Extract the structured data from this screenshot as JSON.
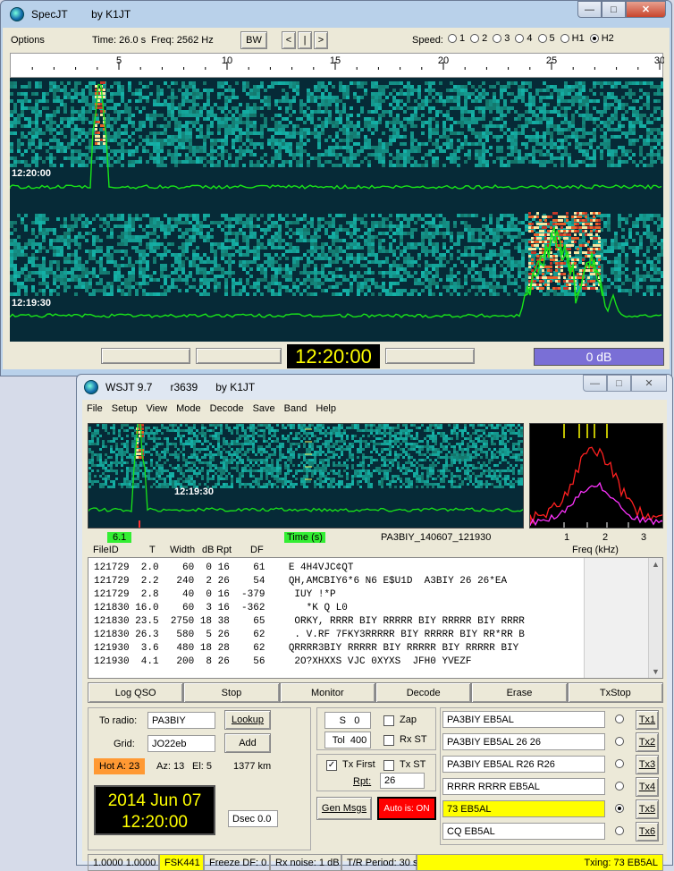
{
  "colors": {
    "wf_bg": "#062a37",
    "trace": "#19e519",
    "signal": "#e8602a",
    "lcd_bg": "#000000",
    "lcd_text": "#ffff00",
    "auto_red": "#ff0000",
    "highlight": "#ffff00",
    "hot": "#ff9933",
    "green_label": "#33ee33"
  },
  "specjt": {
    "title": "SpecJT",
    "by": "by K1JT",
    "options": "Options",
    "time": "Time: 26.0 s",
    "freq": "Freq: 2562 Hz",
    "bw": "BW",
    "nav": [
      "<",
      "|",
      ">"
    ],
    "speed_label": "Speed:",
    "speeds": [
      "1",
      "2",
      "3",
      "4",
      "5",
      "H1",
      "H2"
    ],
    "speed_selected": "H2",
    "scale": [
      "5",
      "10",
      "15",
      "20",
      "25",
      "30"
    ],
    "ts1": "12:20:00",
    "ts2": "12:19:30",
    "clock": "12:20:00",
    "db": "0 dB"
  },
  "wsjt": {
    "title": "WSJT 9.7",
    "rev": "r3639",
    "by": "by K1JT",
    "menu": [
      "File",
      "Setup",
      "View",
      "Mode",
      "Decode",
      "Save",
      "Band",
      "Help"
    ],
    "wf_time": "12:19:30",
    "df_label": "6.1",
    "time_label": "Time (s)",
    "filename": "PA3BIY_140607_121930",
    "freq_ticks": [
      "1",
      "2",
      "3"
    ],
    "freq_label": "Freq (kHz)",
    "headers": [
      "FileID",
      "T",
      "Width",
      "dB",
      "Rpt",
      "DF"
    ],
    "decodes": [
      "121729  2.0    60  0 16    61    E 4H4VJC¢QT",
      "121729  2.2   240  2 26    54    QH,AMCBIY6*6 N6 E$U1D  A3BIY 26 26*EA",
      "121729  2.8    40  0 16  -379     IUY !*P",
      "121830 16.0    60  3 16  -362       *K Q L0",
      "121830 23.5  2750 18 38    65     ORKY, RRRR BIY RRRRR BIY RRRRR BIY RRRR",
      "121830 26.3   580  5 26    62     . V.RF 7FKY3RRRRR BIY RRRRR BIY RR*RR B",
      "121930  3.6   480 18 28    62    QRRRR3BIY RRRRR BIY RRRRR BIY RRRRR BIY",
      "121930  4.1   200  8 26    56     2O?XHXXS VJC 0XYXS  JFH0 YVEZF"
    ],
    "buttons": [
      "Log QSO",
      "Stop",
      "Monitor",
      "Decode",
      "Erase",
      "TxStop"
    ],
    "to_radio_label": "To radio:",
    "to_radio": "PA3BIY",
    "lookup": "Lookup",
    "grid_label": "Grid:",
    "grid": "JO22eb",
    "add": "Add",
    "hot": "Hot A: 23",
    "az": "Az: 13",
    "el": "El: 5",
    "dist": "1377 km",
    "date": "2014 Jun 07",
    "time": "12:20:00",
    "dsec": "Dsec  0.0",
    "s_label": "S",
    "s_val": "0",
    "tol_label": "Tol",
    "tol_val": "400",
    "zap": "Zap",
    "rxst": "Rx ST",
    "txfirst": "Tx First",
    "txst": "Tx ST",
    "rpt_label": "Rpt:",
    "rpt": "26",
    "genmsgs": "Gen Msgs",
    "auto": "Auto is: ON",
    "tx": [
      {
        "msg": "PA3BIY EB5AL",
        "btn": "Tx1"
      },
      {
        "msg": "PA3BIY EB5AL 26 26",
        "btn": "Tx2"
      },
      {
        "msg": "PA3BIY EB5AL R26 R26",
        "btn": "Tx3"
      },
      {
        "msg": "RRRR RRRR EB5AL",
        "btn": "Tx4"
      },
      {
        "msg": "73 EB5AL",
        "btn": "Tx5"
      },
      {
        "msg": "CQ EB5AL",
        "btn": "Tx6"
      }
    ],
    "tx_selected": 4,
    "status": [
      "1.0000 1.0000",
      "FSK441",
      "Freeze DF:  0",
      "Rx noise:  1 dB",
      "T/R Period: 30 s",
      "Txing:  73 EB5AL"
    ]
  }
}
